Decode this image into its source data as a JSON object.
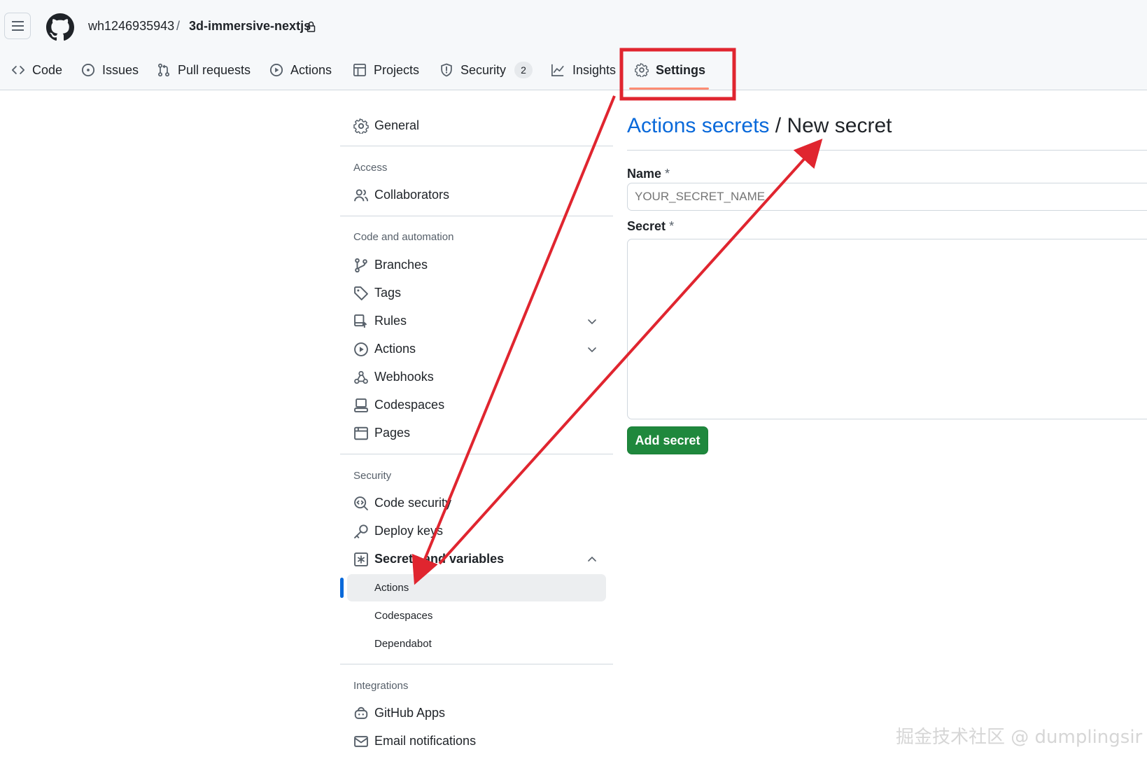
{
  "header": {
    "owner": "wh1246935943",
    "separator": "/",
    "repo": "3d-immersive-nextjs",
    "tabs": [
      {
        "label": "Code"
      },
      {
        "label": "Issues"
      },
      {
        "label": "Pull requests"
      },
      {
        "label": "Actions"
      },
      {
        "label": "Projects"
      },
      {
        "label": "Security",
        "count": "2"
      },
      {
        "label": "Insights"
      },
      {
        "label": "Settings",
        "selected": true
      }
    ]
  },
  "sidebar": {
    "general": "General",
    "sections": [
      {
        "heading": "Access",
        "items": [
          "Collaborators"
        ]
      },
      {
        "heading": "Code and automation",
        "items": [
          "Branches",
          "Tags",
          "Rules",
          "Actions",
          "Webhooks",
          "Codespaces",
          "Pages"
        ]
      },
      {
        "heading": "Security",
        "items": [
          "Code security",
          "Deploy keys",
          "Secrets and variables"
        ],
        "subitems": [
          "Actions",
          "Codespaces",
          "Dependabot"
        ]
      },
      {
        "heading": "Integrations",
        "items": [
          "GitHub Apps",
          "Email notifications"
        ]
      }
    ]
  },
  "main": {
    "breadcrumb_link": "Actions secrets",
    "breadcrumb_sep": "/",
    "title": "New secret",
    "name_label": "Name",
    "secret_label": "Secret",
    "required_mark": "*",
    "name_placeholder": "YOUR_SECRET_NAME",
    "submit_label": "Add secret"
  },
  "watermark": "掘金技术社区 @ dumplingsir",
  "colors": {
    "annotation": "#e0252f",
    "link": "#0969da",
    "button": "#1f883d",
    "active_marker": "#0969da"
  }
}
